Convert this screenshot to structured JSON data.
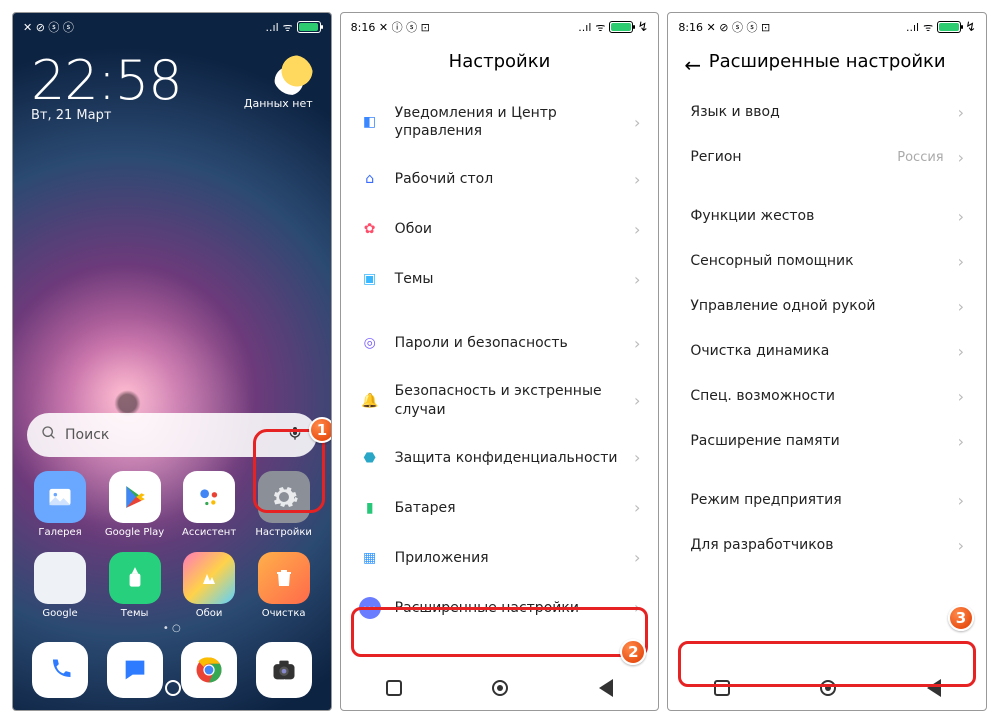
{
  "badges": {
    "b1": "1",
    "b2": "2",
    "b3": "3"
  },
  "phone1": {
    "status_left": "✕ ⊘ ⓢ ⓢ",
    "signal": "..ıl",
    "wifi": "ᯤ",
    "pct": "100",
    "time": "22:58",
    "date": "Вт, 21 Март",
    "weather": "Данных нет",
    "search": "Поиск",
    "apps_row1": [
      {
        "name": "Галерея",
        "bg": "#6aa8ff"
      },
      {
        "name": "Google Play",
        "bg": "#ffffff"
      },
      {
        "name": "Ассистент",
        "bg": "#ffffff"
      },
      {
        "name": "Настройки",
        "bg": "#8b8f98"
      }
    ],
    "apps_row2": [
      {
        "name": "Google",
        "bg": "#eef2f6"
      },
      {
        "name": "Темы",
        "bg": "#26d07c"
      },
      {
        "name": "Обои",
        "bg": "linear-gradient(135deg,#ff7ab8,#ffd24a,#5ad1ff)"
      },
      {
        "name": "Очистка",
        "bg": "linear-gradient(135deg,#ffb04a,#ff6a4a)"
      }
    ],
    "dock": [
      {
        "bg": "#ffffff"
      },
      {
        "bg": "#ffffff"
      },
      {
        "bg": "#ffffff"
      },
      {
        "bg": "#ffffff"
      }
    ]
  },
  "phone2": {
    "time": "8:16",
    "status_icons": "✕ ⓘ ⓢ ⊡",
    "title": "Настройки",
    "items": [
      {
        "label": "Уведомления и Центр управления",
        "color": "#3a87ff"
      },
      {
        "label": "Рабочий стол",
        "color": "#3a6bff"
      },
      {
        "label": "Обои",
        "color": "#ff4d6a"
      },
      {
        "label": "Темы",
        "color": "#3ab8ff"
      }
    ],
    "items2": [
      {
        "label": "Пароли и безопасность",
        "color": "#7a5cff"
      },
      {
        "label": "Безопасность и экстренные случаи",
        "color": "#ff5a4a"
      },
      {
        "label": "Защита конфиденциальности",
        "color": "#2aa7c7"
      },
      {
        "label": "Батарея",
        "color": "#27c77a"
      },
      {
        "label": "Приложения",
        "color": "#3a9bff"
      },
      {
        "label": "Расширенные настройки",
        "color": "#6a7cff"
      }
    ]
  },
  "phone3": {
    "time": "8:16",
    "status_icons": "✕ ⊘ ⓢ ⓢ ⊡",
    "title": "Расширенные настройки",
    "items": [
      {
        "label": "Язык и ввод"
      },
      {
        "label": "Регион",
        "value": "Россия"
      }
    ],
    "items2": [
      {
        "label": "Функции жестов"
      },
      {
        "label": "Сенсорный помощник"
      },
      {
        "label": "Управление одной рукой"
      },
      {
        "label": "Очистка динамика"
      },
      {
        "label": "Спец. возможности"
      },
      {
        "label": "Расширение памяти"
      }
    ],
    "items3": [
      {
        "label": "Режим предприятия"
      },
      {
        "label": "Для разработчиков"
      }
    ]
  }
}
